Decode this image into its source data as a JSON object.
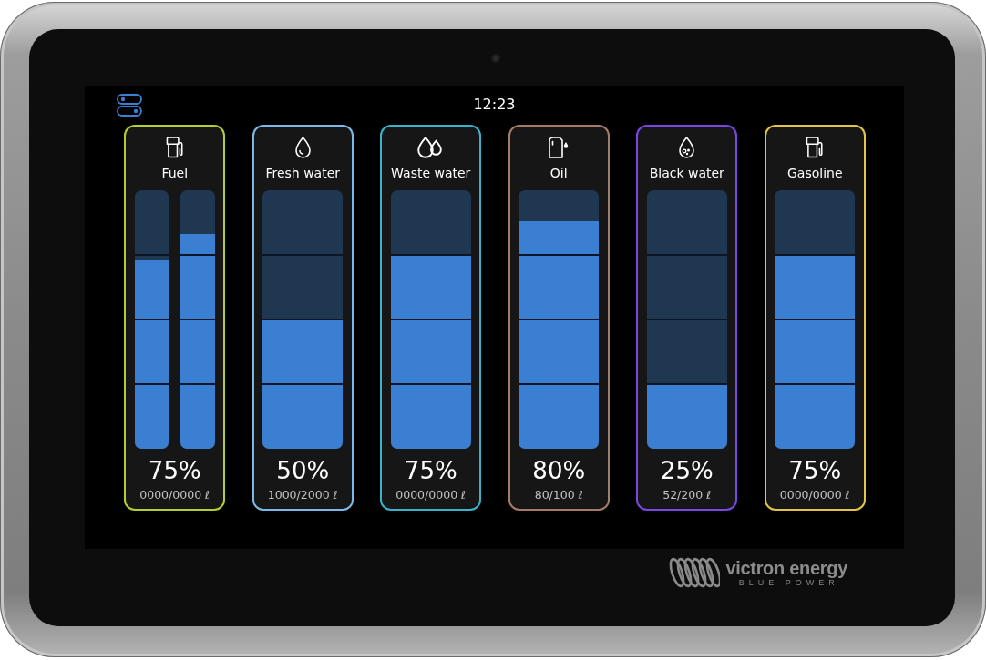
{
  "status_bar": {
    "clock": "12:23"
  },
  "tanks": [
    {
      "kind": "fuel",
      "name": "Fuel",
      "color": "#b7cd2d",
      "bars": [
        {
          "level": 0.73
        },
        {
          "level": 0.83
        }
      ],
      "percent": "75%",
      "volume": "0000/0000 ℓ"
    },
    {
      "kind": "fresh_water",
      "name": "Fresh water",
      "color": "#7cb9e8",
      "bars": [
        {
          "level": 0.5
        }
      ],
      "percent": "50%",
      "volume": "1000/2000 ℓ"
    },
    {
      "kind": "waste_water",
      "name": "Waste water",
      "color": "#38b3c9",
      "bars": [
        {
          "level": 0.75
        }
      ],
      "percent": "75%",
      "volume": "0000/0000 ℓ"
    },
    {
      "kind": "oil",
      "name": "Oil",
      "color": "#a47c67",
      "bars": [
        {
          "level": 0.88
        }
      ],
      "percent": "80%",
      "volume": "80/100 ℓ"
    },
    {
      "kind": "black_water",
      "name": "Black water",
      "color": "#7b46e3",
      "bars": [
        {
          "level": 0.25
        }
      ],
      "percent": "25%",
      "volume": "52/200 ℓ"
    },
    {
      "kind": "fuel",
      "name": "Gasoline",
      "color": "#e2c544",
      "bars": [
        {
          "level": 0.75
        }
      ],
      "percent": "75%",
      "volume": "0000/0000 ℓ"
    }
  ],
  "brand": {
    "name": "victron energy",
    "tagline": "BLUE POWER"
  }
}
